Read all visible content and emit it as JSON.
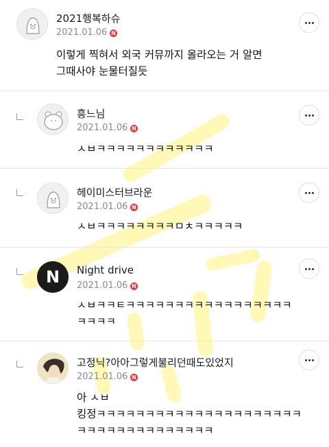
{
  "comments": [
    {
      "nickname": "2021행복하슈",
      "date": "2021.01.06",
      "new_badge": "N",
      "text_lines": [
        "이렇게 찍혀서 외국 커뮤까지 올라오는 거 알면",
        "그때사야 눈물터질듯"
      ]
    },
    {
      "nickname": "흥느님",
      "date": "2021.01.06",
      "new_badge": "N",
      "text_lines": [
        "ㅅㅂㅋㅋㅋㅋㅋㅋㅋㅋㅋㅋㅋㅋ"
      ]
    },
    {
      "nickname": "헤이미스터브라운",
      "date": "2021.01.06",
      "new_badge": "N",
      "text_lines": [
        "ㅅㅂㅋㅋㅋㅋㅋㅋㅋㅋㅁㅊㅋㅋㅋㅋㅋ"
      ]
    },
    {
      "nickname": "Night drive",
      "date": "2021.01.06",
      "new_badge": "N",
      "avatar_letter": "N",
      "text_lines": [
        "ㅅㅂㅋㅋㅌㅋㅋㅋㅋㅋㅋㅋㅋㅋㅋㅋㅋㅋㅋㅋㅋㅋ",
        "ㅋㅋㅋㅋ"
      ]
    },
    {
      "nickname": "고정닉?아아그렇게불리던때도있었지",
      "date": "2021.01.06",
      "new_badge": "N",
      "text_lines": [
        "아 ㅅㅂ",
        "킹정ㅋㅋㅋㅋㅋㅋㅋㅋㅋㅋㅋㅋㅋㅋㅋㅋㅋㅋㅋㅋㅋ",
        "ㅋㅋㅋㅋㅋㅋㅋㅋㅋㅋㅋㅋㅋㅋ"
      ]
    }
  ],
  "icons": {
    "more": "more-dots-icon",
    "reply": "reply-indent-icon",
    "avatar_default": "default-avatar-icon"
  },
  "colors": {
    "new_badge": "#e4383f",
    "highlighter": "#fff27a"
  }
}
